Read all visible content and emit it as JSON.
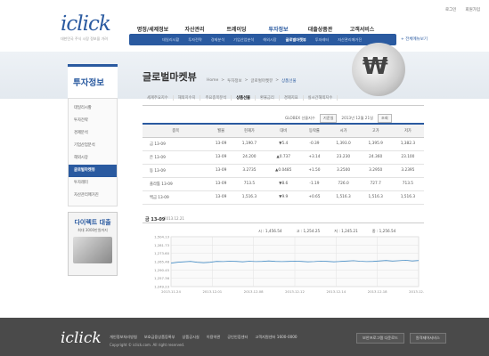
{
  "brand": {
    "logo": "iclick",
    "tagline": "대한민국 주식 시장 정보을 가려"
  },
  "top_links": [
    "로그인",
    "회원가입"
  ],
  "gnb": [
    {
      "label": "명정/세제정보",
      "on": false
    },
    {
      "label": "자산관리",
      "on": false
    },
    {
      "label": "트레이딩",
      "on": false
    },
    {
      "label": "투자정보",
      "on": true
    },
    {
      "label": "대출상품관",
      "on": false
    },
    {
      "label": "고객서비스",
      "on": false
    }
  ],
  "lnb": [
    {
      "label": "데일리시황",
      "on": false
    },
    {
      "label": "투자전략",
      "on": false
    },
    {
      "label": "경제분석",
      "on": false
    },
    {
      "label": "기업산업분석",
      "on": false
    },
    {
      "label": "해외시장",
      "on": false
    },
    {
      "label": "글로벌마켓뷰",
      "on": true
    },
    {
      "label": "투자레터",
      "on": false
    },
    {
      "label": "자산관리매거진",
      "on": false
    }
  ],
  "all_menu": "+ 전체메뉴보기",
  "page": {
    "title": "글로벌마켓뷰",
    "breadcrumb": [
      "Home",
      "투자정보",
      "글로벌마켓뷰",
      "상품선물"
    ]
  },
  "side": {
    "title": "투자정보",
    "items": [
      {
        "label": "데일리시황",
        "on": false
      },
      {
        "label": "투자전략",
        "on": false
      },
      {
        "label": "경제분석",
        "on": false
      },
      {
        "label": "기업산업분석",
        "on": false
      },
      {
        "label": "해외시장",
        "on": false
      },
      {
        "label": "글로벌마켓뷰",
        "on": true
      },
      {
        "label": "투자레터",
        "on": false
      },
      {
        "label": "자산관리매거진",
        "on": false
      }
    ],
    "banner_title": "다이렉트 대출",
    "banner_sub": "최대 3000만원까지"
  },
  "tabs": [
    {
      "label": "세계주요지수",
      "on": false
    },
    {
      "label": "해외지수지",
      "on": false
    },
    {
      "label": "주요종목분석",
      "on": false
    },
    {
      "label": "상품선물",
      "on": true
    },
    {
      "label": "환율금리",
      "on": false
    },
    {
      "label": "경제지표",
      "on": false
    },
    {
      "label": "실시간해외지수",
      "on": false
    }
  ],
  "info": {
    "source": "GLOBEX 선물지수",
    "btn1": "기준일",
    "date": "2013년 12월 21일",
    "btn2": "조회"
  },
  "table": {
    "headers": [
      "종목",
      "월물",
      "현재가",
      "대비",
      "등락률",
      "시가",
      "고가",
      "저가"
    ],
    "rows": [
      {
        "name": "금 13-09",
        "month": "13-09",
        "price": "1,190.7",
        "chg": "▼5.4",
        "rate": "-0.39",
        "open": "1,393.0",
        "high": "1,395.9",
        "low": "1,382.3",
        "dir": "down"
      },
      {
        "name": "은 13-09",
        "month": "13-09",
        "price": "24.200",
        "chg": "▲0.737",
        "rate": "+3.14",
        "open": "23.230",
        "high": "24.360",
        "low": "23.100",
        "dir": "up"
      },
      {
        "name": "동 13-09",
        "month": "13-09",
        "price": "3.2735",
        "chg": "▲0.0485",
        "rate": "+1.50",
        "open": "3.2500",
        "high": "3.2950",
        "low": "3.2395",
        "dir": "up"
      },
      {
        "name": "플라튬 13-09",
        "month": "13-09",
        "price": "713.5",
        "chg": "▼8.6",
        "rate": "-1.19",
        "open": "726.0",
        "high": "727.7",
        "low": "713.5",
        "dir": "down"
      },
      {
        "name": "백금 13-09",
        "month": "13-09",
        "price": "1,516.3",
        "chg": "▼9.9",
        "rate": "+0.65",
        "open": "1,516.3",
        "high": "1,516.3",
        "low": "1,516.3",
        "dir": "down"
      }
    ]
  },
  "chart_data": {
    "type": "line",
    "title": "금 13-09",
    "subtitle": "2013.12.21",
    "legend": [
      "시 : 1,456.54",
      "고 : 1,254.25",
      "저 : 1,245.21",
      "종 : 1,256.54"
    ],
    "x": [
      "2013.11.24",
      "2013.12.01",
      "2013.12.08",
      "2013.12.12",
      "2013.12.14",
      "2013.12.18",
      "2013.12.21"
    ],
    "yticks": [
      "1,504.13",
      "1,281.73",
      "1,273.60",
      "1,265.48",
      "1,290.45",
      "1,257.36",
      "1,249.23"
    ],
    "ylim": [
      1249.23,
      1304.13
    ],
    "values": [
      1275,
      1276,
      1276.5,
      1277,
      1276,
      1275.5,
      1276,
      1277,
      1276.8,
      1277.2,
      1277,
      1276.5,
      1277.2,
      1276.8,
      1277,
      1277.5,
      1277,
      1276.8,
      1277,
      1277.3,
      1277,
      1276.5,
      1276.8,
      1277.3,
      1277,
      1276.5,
      1277,
      1277.4,
      1277.8,
      1277.2,
      1276.8,
      1277,
      1277.5,
      1278,
      1277.4,
      1277.8,
      1278.2,
      1277.5,
      1278
    ],
    "color": "#4a90c8"
  },
  "footer": {
    "logo": "iclick",
    "links": [
      "개인정보처리방침",
      "보호금융상품등록부",
      "상품공시실",
      "이용약관",
      "공인인증센터",
      "고객지원센터 1600-0000"
    ],
    "copy": "Copyright © iclick.com. All right reserved.",
    "btns": [
      "보안프로그램 다운로드",
      "원격제어서비스"
    ]
  }
}
